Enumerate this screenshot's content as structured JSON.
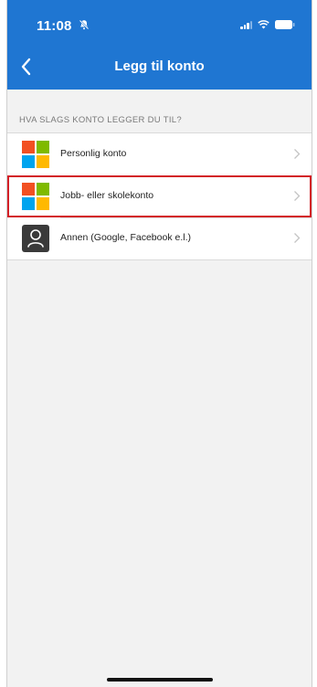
{
  "status_bar": {
    "time": "11:08",
    "icons": [
      "bell-slash-icon",
      "signal-icon",
      "wifi-icon",
      "battery-icon"
    ]
  },
  "nav": {
    "back_icon": "chevron-left-icon",
    "title": "Legg til konto"
  },
  "section": {
    "label": "HVA SLAGS KONTO LEGGER DU TIL?"
  },
  "accounts": [
    {
      "label": "Personlig konto",
      "icon": "microsoft-logo-icon"
    },
    {
      "label": "Jobb- eller skolekonto",
      "icon": "microsoft-logo-icon",
      "highlighted": true
    },
    {
      "label": "Annen (Google, Facebook e.l.)",
      "icon": "person-icon"
    }
  ],
  "colors": {
    "header": "#1f76d2",
    "background": "#f2f2f2",
    "highlight_border": "#d32027",
    "ms_red": "#f25022",
    "ms_green": "#7fba00",
    "ms_blue": "#00a4ef",
    "ms_yellow": "#ffb900"
  }
}
